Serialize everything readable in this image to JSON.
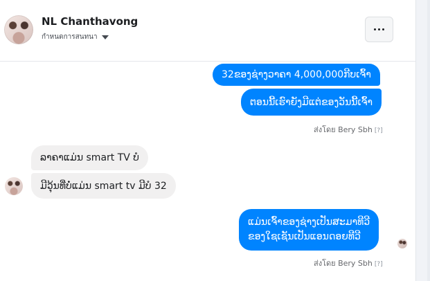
{
  "header": {
    "name": "NL Chanthavong",
    "subtitle": "กำหนดการสนทนา",
    "more_icon": "more-dots-icon"
  },
  "messages": [
    {
      "side": "out",
      "text": "32ຂອງຊ່າງວາຄາ 4,000,000ກີບເຈົ້າ"
    },
    {
      "side": "out",
      "text": "ຕອນນີ້ເຮົາຍັງມີແຕ່ຂອງວັນນີ້ເຈົ້າ"
    },
    {
      "side": "in",
      "text": "ລາຄາແມ່ນ smart TV ບໍ"
    },
    {
      "side": "in",
      "text": "ມີວຸ້ນທີ່ບໍ່ແມ່ນ smart tv ມີບໍ 32"
    },
    {
      "side": "out",
      "text": "ແມ່ນເຈົ້າຂອງຊ່າງເປັນສະມາທີວີ"
    },
    {
      "side": "out",
      "text": "ຂອງໃຊເຊັນເປັນແອນດອຍທີວີ"
    }
  ],
  "status": {
    "sent_by_1": "ส่งโดย Bery Sbh",
    "sent_by_2": "ส่งโดย Bery Sbh",
    "help_marker": "[?]"
  }
}
